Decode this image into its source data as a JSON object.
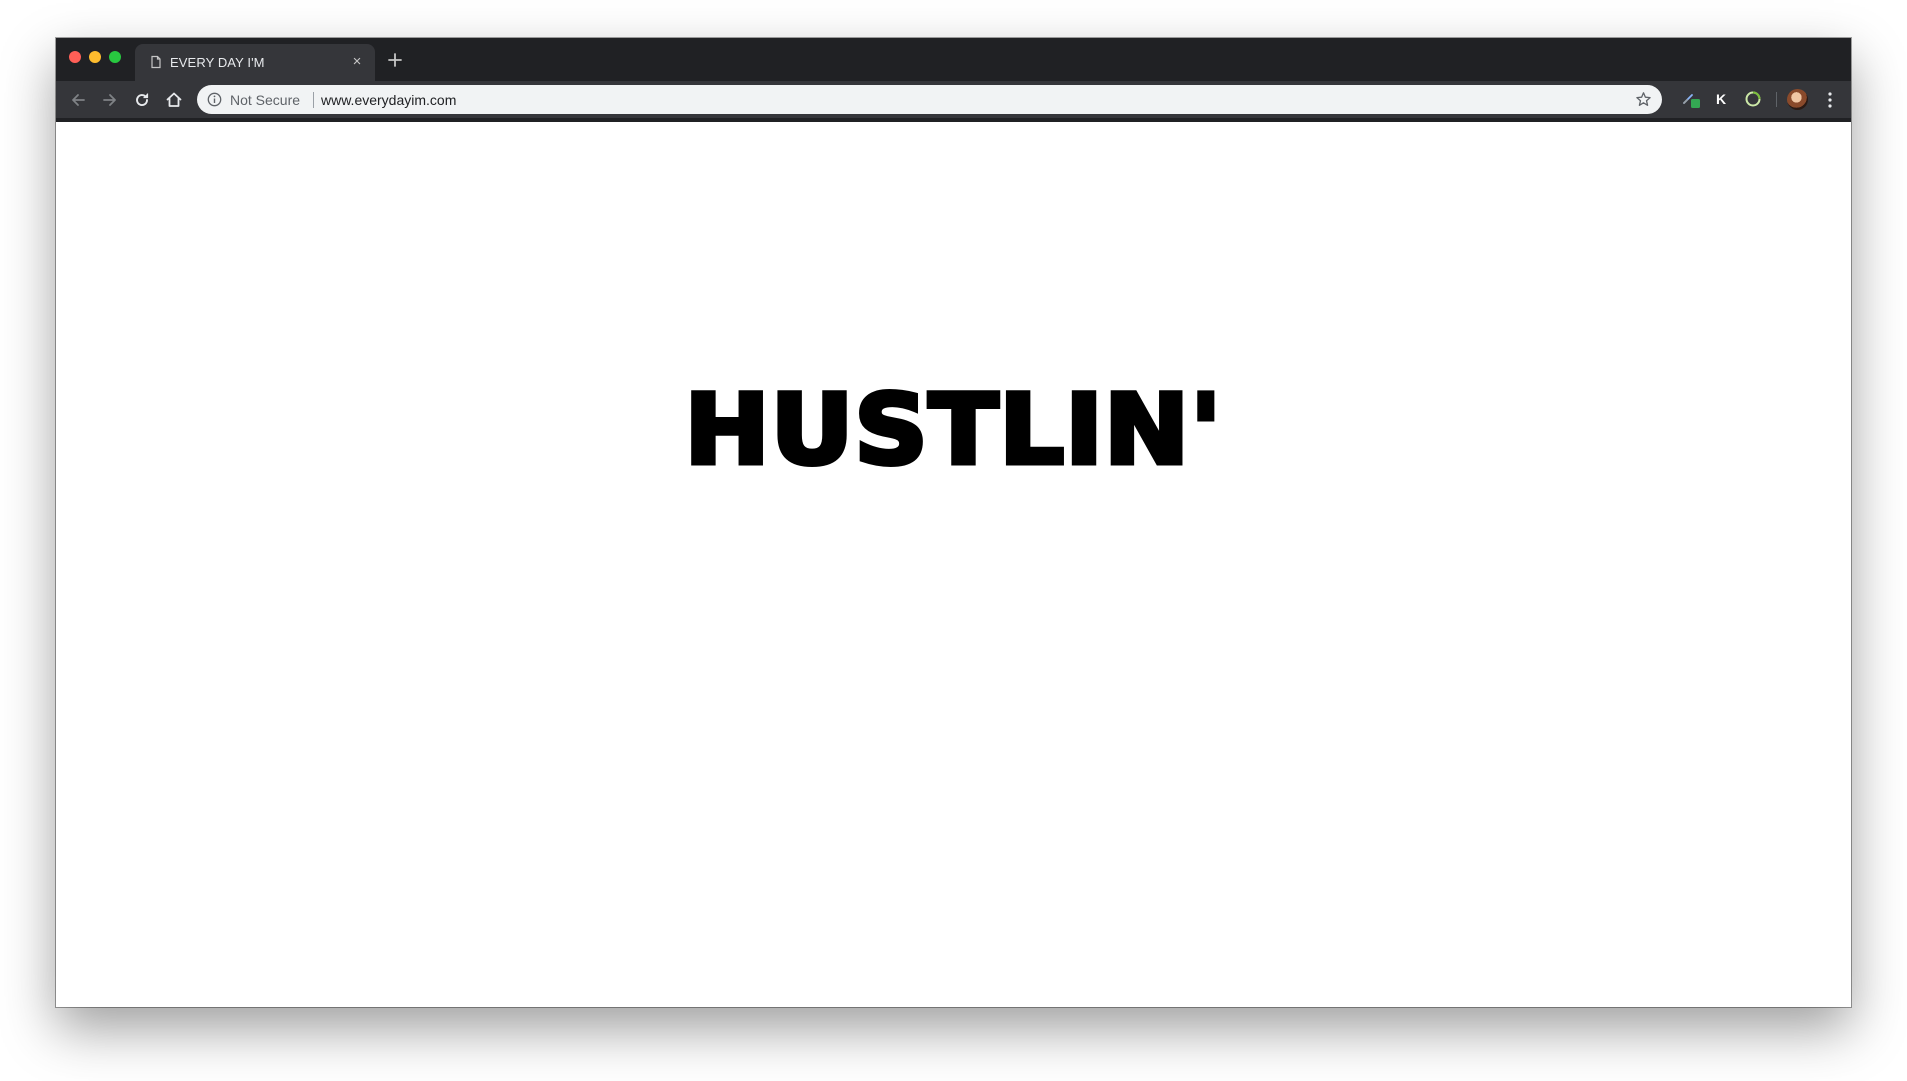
{
  "browser": {
    "tab": {
      "title": "EVERY DAY I'M",
      "close_glyph": "×"
    },
    "toolbar": {
      "security_label": "Not Secure",
      "url": "www.everydayim.com",
      "extension_k_label": "K"
    },
    "icons": {
      "back": "back-arrow-icon",
      "forward": "forward-arrow-icon",
      "reload": "reload-icon",
      "home": "home-icon",
      "info": "info-icon",
      "bookmark": "star-icon",
      "menu": "kebab-menu-icon"
    },
    "colors": {
      "close": "#ff5f57",
      "minimize": "#febc2e",
      "maximize": "#28c840",
      "chrome_dark": "#202124",
      "toolbar": "#35363a",
      "extension_green": "#34a853"
    }
  },
  "page": {
    "headline": "HUSTLIN'"
  }
}
